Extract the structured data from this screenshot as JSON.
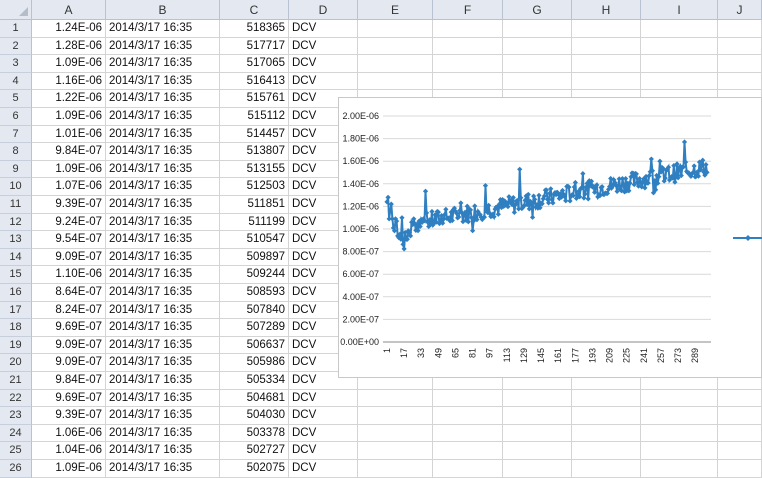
{
  "columns": [
    "A",
    "B",
    "C",
    "D",
    "E",
    "F",
    "G",
    "H",
    "I",
    "J"
  ],
  "rows": [
    {
      "n": "1",
      "a": "1.24E-06",
      "b": "2014/3/17 16:35",
      "c": "518365",
      "d": "DCV"
    },
    {
      "n": "2",
      "a": "1.28E-06",
      "b": "2014/3/17 16:35",
      "c": "517717",
      "d": "DCV"
    },
    {
      "n": "3",
      "a": "1.09E-06",
      "b": "2014/3/17 16:35",
      "c": "517065",
      "d": "DCV"
    },
    {
      "n": "4",
      "a": "1.16E-06",
      "b": "2014/3/17 16:35",
      "c": "516413",
      "d": "DCV"
    },
    {
      "n": "5",
      "a": "1.22E-06",
      "b": "2014/3/17 16:35",
      "c": "515761",
      "d": "DCV"
    },
    {
      "n": "6",
      "a": "1.09E-06",
      "b": "2014/3/17 16:35",
      "c": "515112",
      "d": "DCV"
    },
    {
      "n": "7",
      "a": "1.01E-06",
      "b": "2014/3/17 16:35",
      "c": "514457",
      "d": "DCV"
    },
    {
      "n": "8",
      "a": "9.84E-07",
      "b": "2014/3/17 16:35",
      "c": "513807",
      "d": "DCV"
    },
    {
      "n": "9",
      "a": "1.09E-06",
      "b": "2014/3/17 16:35",
      "c": "513155",
      "d": "DCV"
    },
    {
      "n": "10",
      "a": "1.07E-06",
      "b": "2014/3/17 16:35",
      "c": "512503",
      "d": "DCV"
    },
    {
      "n": "11",
      "a": "9.39E-07",
      "b": "2014/3/17 16:35",
      "c": "511851",
      "d": "DCV"
    },
    {
      "n": "12",
      "a": "9.24E-07",
      "b": "2014/3/17 16:35",
      "c": "511199",
      "d": "DCV"
    },
    {
      "n": "13",
      "a": "9.54E-07",
      "b": "2014/3/17 16:35",
      "c": "510547",
      "d": "DCV"
    },
    {
      "n": "14",
      "a": "9.09E-07",
      "b": "2014/3/17 16:35",
      "c": "509897",
      "d": "DCV"
    },
    {
      "n": "15",
      "a": "1.10E-06",
      "b": "2014/3/17 16:35",
      "c": "509244",
      "d": "DCV"
    },
    {
      "n": "16",
      "a": "8.64E-07",
      "b": "2014/3/17 16:35",
      "c": "508593",
      "d": "DCV"
    },
    {
      "n": "17",
      "a": "8.24E-07",
      "b": "2014/3/17 16:35",
      "c": "507840",
      "d": "DCV"
    },
    {
      "n": "18",
      "a": "9.69E-07",
      "b": "2014/3/17 16:35",
      "c": "507289",
      "d": "DCV"
    },
    {
      "n": "19",
      "a": "9.09E-07",
      "b": "2014/3/17 16:35",
      "c": "506637",
      "d": "DCV"
    },
    {
      "n": "20",
      "a": "9.09E-07",
      "b": "2014/3/17 16:35",
      "c": "505986",
      "d": "DCV"
    },
    {
      "n": "21",
      "a": "9.84E-07",
      "b": "2014/3/17 16:35",
      "c": "505334",
      "d": "DCV"
    },
    {
      "n": "22",
      "a": "9.69E-07",
      "b": "2014/3/17 16:35",
      "c": "504681",
      "d": "DCV"
    },
    {
      "n": "23",
      "a": "9.39E-07",
      "b": "2014/3/17 16:35",
      "c": "504030",
      "d": "DCV"
    },
    {
      "n": "24",
      "a": "1.06E-06",
      "b": "2014/3/17 16:35",
      "c": "503378",
      "d": "DCV"
    },
    {
      "n": "25",
      "a": "1.04E-06",
      "b": "2014/3/17 16:35",
      "c": "502727",
      "d": "DCV"
    },
    {
      "n": "26",
      "a": "1.09E-06",
      "b": "2014/3/17 16:35",
      "c": "502075",
      "d": "DCV"
    }
  ],
  "chart_data": {
    "type": "line",
    "title": "",
    "xlabel": "",
    "ylabel": "",
    "series_color": "#2f7fc1",
    "ylim": [
      0,
      2e-06
    ],
    "yticks": [
      "0.00E+00",
      "2.00E-07",
      "4.00E-07",
      "6.00E-07",
      "8.00E-07",
      "1.00E-06",
      "1.20E-06",
      "1.40E-06",
      "1.60E-06",
      "1.80E-06",
      "2.00E-06"
    ],
    "xticks": [
      "1",
      "17",
      "33",
      "49",
      "65",
      "81",
      "97",
      "113",
      "129",
      "145",
      "161",
      "177",
      "193",
      "209",
      "225",
      "241",
      "257",
      "273",
      "289"
    ],
    "point_count": 300,
    "trend_start": 1e-06,
    "trend_end": 1.55e-06,
    "series": [
      {
        "values": [
          1.24e-06,
          1.28e-06,
          1.09e-06,
          1.16e-06,
          1.22e-06,
          1.09e-06,
          1.01e-06,
          9.84e-07,
          1.09e-06,
          1.07e-06,
          9.39e-07,
          9.24e-07,
          9.54e-07,
          9.09e-07,
          1.1e-06,
          8.64e-07,
          8.24e-07,
          9.69e-07,
          9.09e-07,
          9.09e-07,
          9.84e-07,
          9.69e-07,
          9.39e-07,
          1.06e-06,
          1.04e-06,
          1.09e-06
        ]
      }
    ],
    "legend_placement": "right"
  }
}
